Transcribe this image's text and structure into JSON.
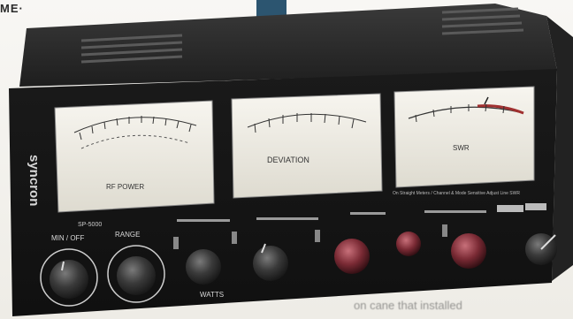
{
  "page": {
    "top_left_text": "ME·",
    "bottom_text": "on cane that installed"
  },
  "device": {
    "brand": "syncron",
    "model": "SP-5000",
    "meters": [
      {
        "label": "RF POWER"
      },
      {
        "label": "DEVIATION"
      },
      {
        "label": "SWR"
      }
    ],
    "meter_caption": "On Straight Meters / Channel & Mode Sensitive Adjust Line SWR",
    "knob_labels": [
      "MIN / OFF",
      "RANGE",
      "WATTS"
    ],
    "colors": {
      "case": "#1c1c1c",
      "case_top": "#2a2a2a",
      "meter_face": "#eeebe2",
      "knob": "#3a3a3a",
      "knob_red": "#8a2a32",
      "text_light": "#d8d8d8"
    }
  }
}
